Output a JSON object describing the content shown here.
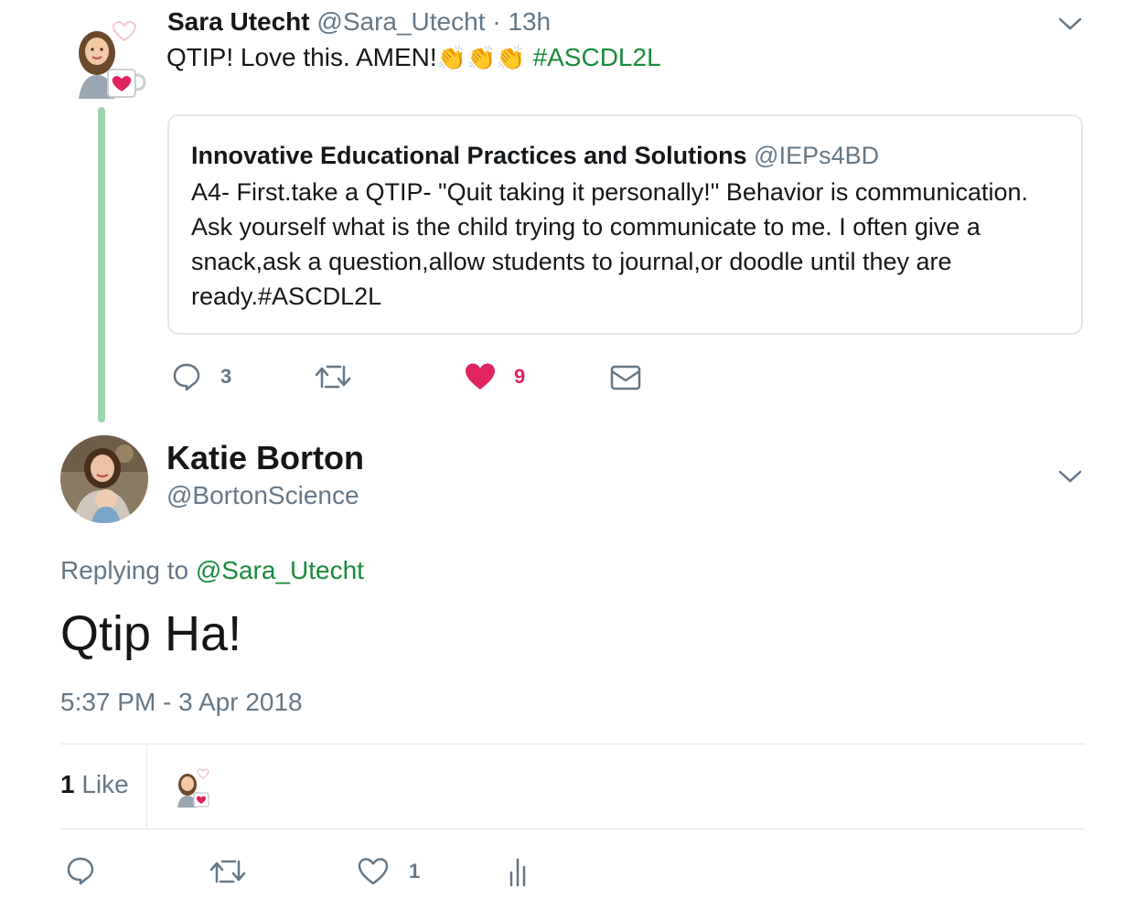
{
  "parent_tweet": {
    "author_name": "Sara Utecht",
    "handle": "@Sara_Utecht",
    "separator": "·",
    "time": "13h",
    "text": "QTIP!  Love this.  AMEN!",
    "emoji": "👏👏👏",
    "hashtag": "#ASCDL2L",
    "quoted": {
      "author_name": "Innovative Educational Practices and Solutions",
      "handle": "@IEPs4BD",
      "text": "A4- First.take a QTIP- \"Quit taking it personally!\" Behavior is communication. Ask yourself what is the child trying to communicate to me. I often give a snack,ask a question,allow students to journal,or doodle until they are ready.#ASCDL2L"
    },
    "actions": {
      "reply_count": "3",
      "retweet_count": "",
      "like_count": "9"
    }
  },
  "main_tweet": {
    "author_name": "Katie Borton",
    "handle": "@BortonScience",
    "replying_label": "Replying to",
    "replying_to": "@Sara_Utecht",
    "text": "Qtip Ha!",
    "timestamp": "5:37 PM - 3 Apr 2018",
    "likes_count": "1",
    "likes_label": "Like",
    "actions": {
      "like_count": "1"
    }
  },
  "colors": {
    "accent_green": "#1a8a3d",
    "like_red": "#e0245e",
    "secondary_text": "#657786",
    "border": "#e1e8ed",
    "thread_line": "#9ed3b0"
  },
  "icons": [
    "chevron-down-icon",
    "reply-icon",
    "retweet-icon",
    "heart-icon",
    "envelope-icon",
    "analytics-icon"
  ]
}
